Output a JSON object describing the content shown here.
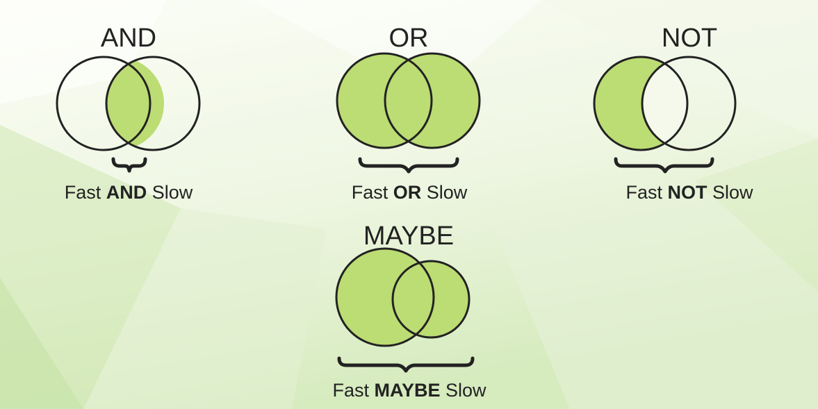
{
  "colors": {
    "fill": "#bcdc74",
    "stroke": "#222222",
    "text": "#222222",
    "background_light": "#f7fbef",
    "background_green": "#d7ecbf"
  },
  "diagrams": {
    "and": {
      "title": "AND",
      "caption": {
        "before": "Fast ",
        "keyword": "AND",
        "after": " Slow"
      }
    },
    "or": {
      "title": "OR",
      "caption": {
        "before": "Fast ",
        "keyword": "OR",
        "after": " Slow"
      }
    },
    "not": {
      "title": "NOT",
      "caption": {
        "before": "Fast ",
        "keyword": "NOT",
        "after": " Slow"
      }
    },
    "maybe": {
      "title": "MAYBE",
      "caption": {
        "before": "Fast ",
        "keyword": "MAYBE",
        "after": " Slow"
      }
    }
  }
}
